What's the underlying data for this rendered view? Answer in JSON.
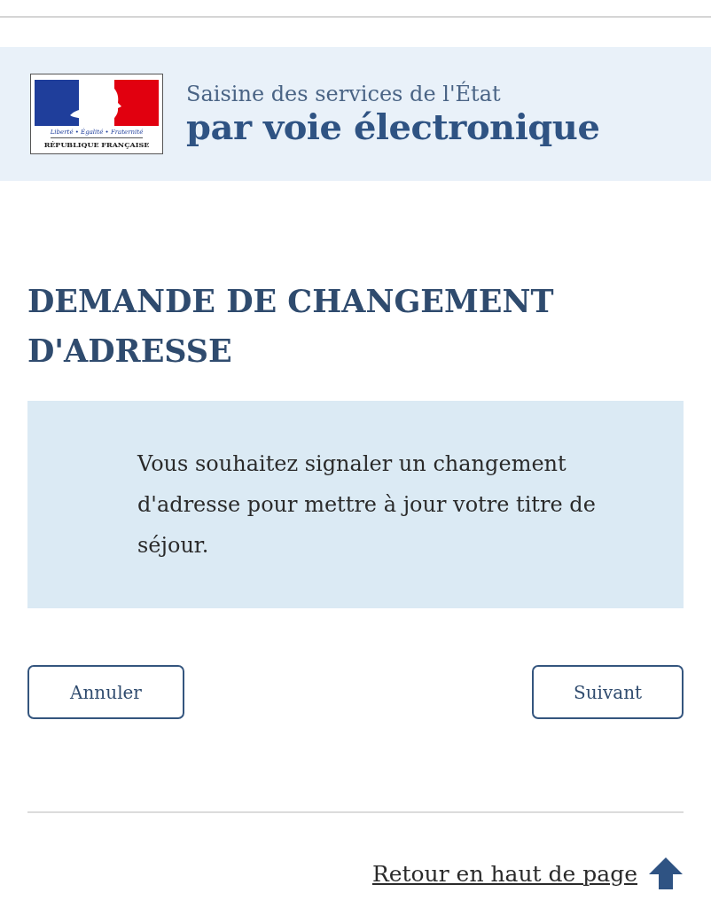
{
  "header": {
    "logo": {
      "motto": "Liberté • Égalité • Fraternité",
      "name": "RÉPUBLIQUE FRANÇAISE"
    },
    "subtitle": "Saisine des services de l'État",
    "title": "par voie électronique"
  },
  "heading": "DEMANDE DE CHANGEMENT D'ADRESSE",
  "info": "Vous souhaitez signaler un changement d'adresse pour mettre à jour votre titre de séjour.",
  "buttons": [
    {
      "label": "Annuler",
      "kind": "cancel"
    },
    {
      "label": "Suivant",
      "kind": "next"
    }
  ],
  "back_to_top": "Retour en haut de page"
}
